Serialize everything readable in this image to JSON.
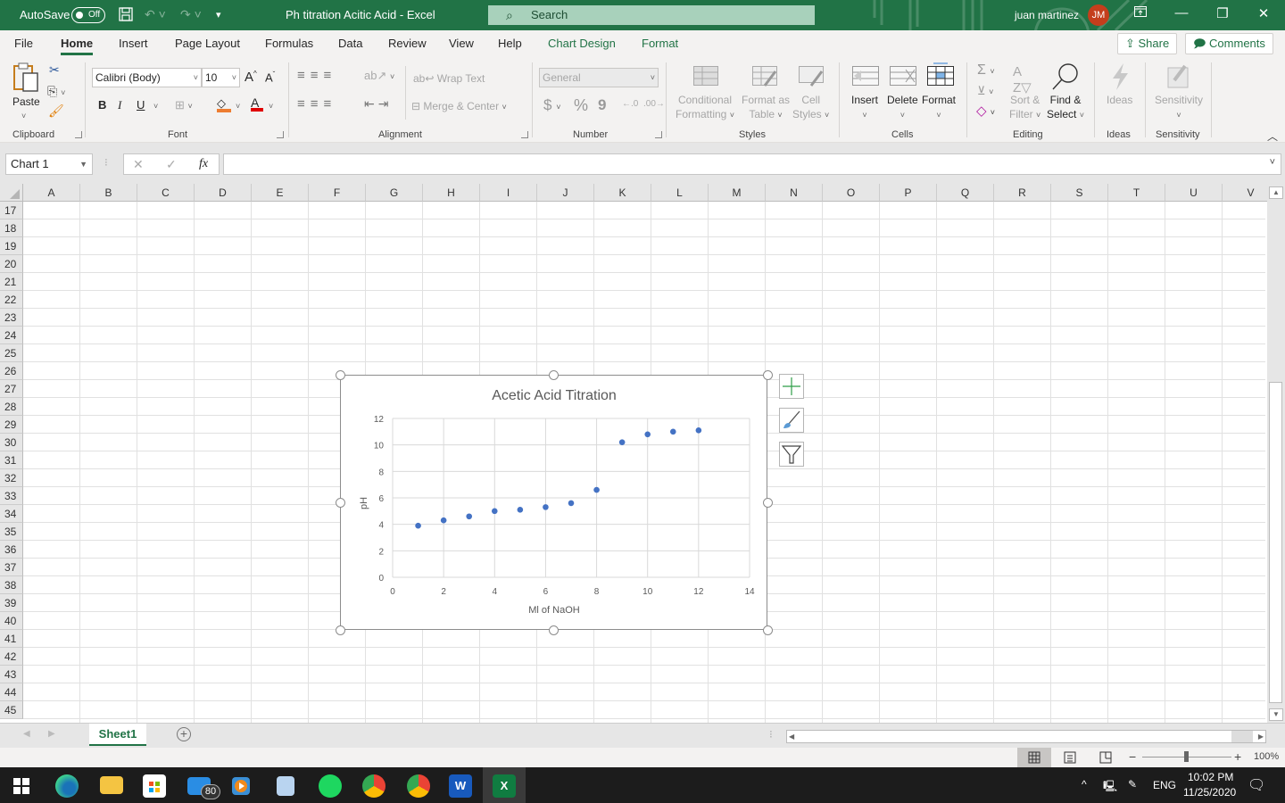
{
  "titlebar": {
    "autosave_label": "AutoSave",
    "autosave_state": "Off",
    "title": "Ph titration Acitic Acid  -  Excel",
    "search_placeholder": "Search",
    "user_name": "juan martinez",
    "user_initials": "JM"
  },
  "menu": {
    "items": [
      "File",
      "Home",
      "Insert",
      "Page Layout",
      "Formulas",
      "Data",
      "Review",
      "View",
      "Help",
      "Chart Design",
      "Format"
    ],
    "active": "Home",
    "share_label": "Share",
    "comments_label": "Comments"
  },
  "ribbon": {
    "clipboard": {
      "paste": "Paste",
      "label": "Clipboard"
    },
    "font": {
      "name": "Calibri (Body)",
      "size": "10",
      "bold": "B",
      "italic": "I",
      "underline": "U",
      "label": "Font",
      "fill_color": "#ed7d31",
      "font_color": "#e00000"
    },
    "alignment": {
      "wrap_text": "Wrap Text",
      "merge_center": "Merge & Center",
      "label": "Alignment"
    },
    "number": {
      "format": "General",
      "currency": "$",
      "percent": "%",
      "comma": "9",
      "label": "Number"
    },
    "styles": {
      "conditional_1": "Conditional",
      "conditional_2": "Formatting",
      "format_table_1": "Format as",
      "format_table_2": "Table",
      "cell_styles_1": "Cell",
      "cell_styles_2": "Styles",
      "label": "Styles"
    },
    "cells": {
      "insert": "Insert",
      "delete": "Delete",
      "format": "Format",
      "label": "Cells"
    },
    "editing": {
      "sort_1": "Sort &",
      "sort_2": "Filter",
      "find_1": "Find &",
      "find_2": "Select",
      "label": "Editing"
    },
    "ideas": {
      "button": "Ideas",
      "label": "Ideas"
    },
    "sensitivity": {
      "button": "Sensitivity",
      "label": "Sensitivity"
    }
  },
  "formula_bar": {
    "name_box": "Chart 1",
    "fx": "fx",
    "formula": ""
  },
  "grid": {
    "columns": [
      "A",
      "B",
      "C",
      "D",
      "E",
      "F",
      "G",
      "H",
      "I",
      "J",
      "K",
      "L",
      "M",
      "N",
      "O",
      "P",
      "Q",
      "R",
      "S",
      "T",
      "U",
      "V"
    ],
    "rows": [
      "17",
      "18",
      "19",
      "20",
      "21",
      "22",
      "23",
      "24",
      "25",
      "26",
      "27",
      "28",
      "29",
      "30",
      "31",
      "32",
      "33",
      "34",
      "35",
      "36",
      "37",
      "38",
      "39",
      "40",
      "41",
      "42",
      "43",
      "44",
      "45"
    ]
  },
  "chart_data": {
    "type": "scatter",
    "title": "Acetic Acid Titration",
    "xlabel": "Ml of NaOH",
    "ylabel": "pH",
    "x": [
      1,
      2,
      3,
      4,
      5,
      6,
      7,
      8,
      9,
      10,
      11,
      12
    ],
    "y": [
      3.9,
      4.3,
      4.6,
      5.0,
      5.1,
      5.3,
      5.6,
      6.6,
      10.2,
      10.8,
      11.0,
      11.1
    ],
    "xlim": [
      0,
      14
    ],
    "ylim": [
      0,
      12
    ],
    "xticks": [
      "0",
      "2",
      "4",
      "6",
      "8",
      "10",
      "12",
      "14"
    ],
    "yticks": [
      "0",
      "2",
      "4",
      "6",
      "8",
      "10",
      "12"
    ],
    "grid": true,
    "legend": "none",
    "marker_color": "#4472c4"
  },
  "sheets": {
    "tabs": [
      "Sheet1"
    ],
    "active": "Sheet1"
  },
  "status": {
    "zoom": "100%",
    "zoom_minus": "−",
    "zoom_plus": "+"
  },
  "taskbar": {
    "mail_badge": "80",
    "language": "ENG",
    "time": "10:02 PM",
    "date": "11/25/2020"
  }
}
